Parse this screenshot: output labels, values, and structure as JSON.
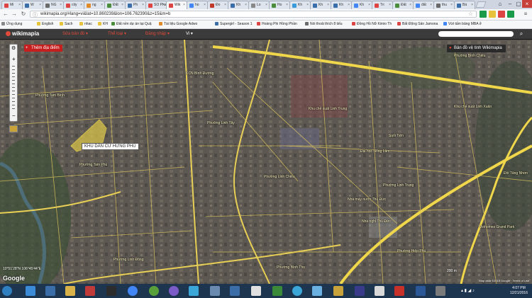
{
  "browser": {
    "tabs": [
      {
        "label": "Mi",
        "color": "#d44"
      },
      {
        "label": "W",
        "color": "#3b6ea8"
      },
      {
        "label": "NG",
        "color": "#6a6a6a"
      },
      {
        "label": "city",
        "color": "#d44"
      },
      {
        "label": "ng",
        "color": "#e08a2a"
      },
      {
        "label": "Đất",
        "color": "#4a8d3a"
      },
      {
        "label": "Ph",
        "color": "#3b6ea8"
      },
      {
        "label": "SO Pha",
        "color": "#d44"
      },
      {
        "label": "Wik",
        "color": "#d44"
      },
      {
        "label": "ho",
        "color": "#4285f4"
      },
      {
        "label": "Đo",
        "color": "#c0392b"
      },
      {
        "label": "Kh",
        "color": "#3b6ea8"
      },
      {
        "label": "Lo",
        "color": "#888"
      },
      {
        "label": "Ho",
        "color": "#4a8d3a"
      },
      {
        "label": "Kh",
        "color": "#3b9ad9"
      },
      {
        "label": "Kh",
        "color": "#3b6ea8"
      },
      {
        "label": "Kh",
        "color": "#3b6ea8"
      },
      {
        "label": "Kh",
        "color": "#4285f4"
      },
      {
        "label": "Tri",
        "color": "#d44"
      },
      {
        "label": "Đất",
        "color": "#4a8d3a"
      },
      {
        "label": "đất",
        "color": "#4285f4"
      },
      {
        "label": "thu",
        "color": "#6a6a6a"
      },
      {
        "label": "Bá",
        "color": "#3b6ea8"
      }
    ],
    "active_tab_index": 8,
    "url": "wikimapia.org/#lang=vi&lat=10.860239&lon=106.762390&z=15&m=b",
    "bookmarks": [
      {
        "label": "Ứng dụng",
        "color": "#888"
      },
      {
        "label": "English",
        "color": "#e8c23a"
      },
      {
        "label": "Sach",
        "color": "#e8c23a"
      },
      {
        "label": "nhac",
        "color": "#e8c23a"
      },
      {
        "label": "KH",
        "color": "#e8c23a"
      },
      {
        "label": "Đất nền dự án tại Quậ",
        "color": "#4a8d3a"
      },
      {
        "label": "Tài liệu Google Adwo",
        "color": "#e08a2a"
      },
      {
        "label": "Supergirl - Season 1",
        "color": "#3b6ea8"
      },
      {
        "label": "Hoàng Phi Hồng Phần",
        "color": "#d44"
      },
      {
        "label": "Nói thoải thích 8 tiếu",
        "color": "#6a6a6a"
      },
      {
        "label": "Đồng Hồ Nữ Kimio Th",
        "color": "#d44"
      },
      {
        "label": "Bất Động Sản Jamona",
        "color": "#d44"
      },
      {
        "label": "Vừt tấm bảng MBA ở",
        "color": "#4285f4"
      }
    ]
  },
  "wikimapia": {
    "logo": "wikimapia",
    "menu": [
      {
        "label": "Sửa bản đồ ▾",
        "color": "#e04a3a"
      },
      {
        "label": "Thể loại ▾",
        "color": "#e04a3a"
      },
      {
        "label": "Đăng nhập ▾",
        "color": "#e04a3a"
      },
      {
        "label": "Vi ▾",
        "color": "#ffffff"
      }
    ],
    "search_placeholder": ""
  },
  "map": {
    "add_place": "Thêm địa điểm",
    "satellite_button": "Bản đồ vệ tinh Wikimapia",
    "highlight_label": "KHU DÂN CƯ HƯNG PHÚ",
    "labels": [
      "KCN Bình Đường",
      "Phường Tam Bình",
      "Phường Tam Phú",
      "Phường Linh Tây",
      "Phường Linh Chiểu",
      "Nhà máy nước Thủ Đức",
      "Khu chế xuất Linh Trung",
      "Đại học Nông Lâm",
      "Phường Bình Thọ",
      "Phường Hiệp Phú",
      "Phường Linh Trung",
      "Đồi Tăng Nhơn",
      "Khu chế xuất Linh Xuân",
      "Phường Linh Đông",
      "Phường Bình Chiểu",
      "Nhà nghỉ Thủ Đức",
      "Vinhomes Grand Park",
      "Suối Tiên"
    ],
    "coordinates": "10°51'28\"N 106°45'44\"E",
    "google": "Google",
    "footer": "Map data ©2016 Google · Terms of Use",
    "scale": "200 m"
  },
  "taskbar": {
    "time": "4:07 PM",
    "date": "12/21/2016"
  }
}
